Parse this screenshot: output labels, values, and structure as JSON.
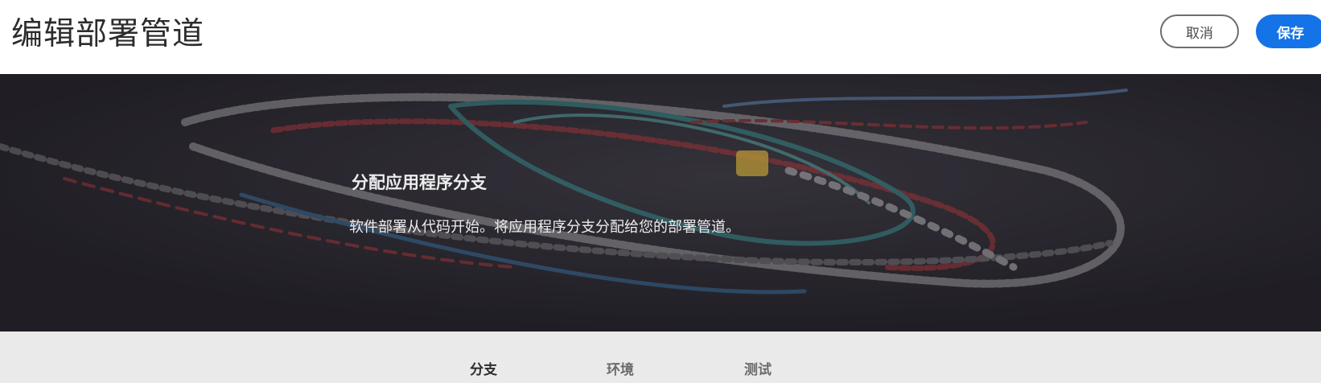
{
  "header": {
    "title": "编辑部署管道",
    "cancel_label": "取消",
    "save_label": "保存"
  },
  "hero": {
    "title": "分配应用程序分支",
    "description": "软件部署从代码开始。将应用程序分支分配给您的部署管道。"
  },
  "tabs": [
    {
      "label": "分支",
      "selected": true
    },
    {
      "label": "环境",
      "selected": false
    },
    {
      "label": "测试",
      "selected": false
    }
  ],
  "colors": {
    "accent": "#1473e6",
    "hero_background": "#232128",
    "tab_bar_background": "#eaeaea"
  }
}
